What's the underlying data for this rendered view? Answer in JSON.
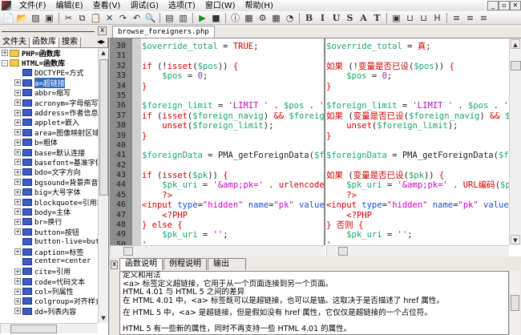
{
  "menu": [
    "文件(F)",
    "编辑(E)",
    "查看(V)",
    "调试(G)",
    "选项(T)",
    "窗口(W)",
    "帮助(H)"
  ],
  "window_controls": [
    "_",
    "▫",
    "✕"
  ],
  "toolbar": [
    "📄",
    "📂",
    "▨",
    "▣",
    "✂",
    "⧉",
    "📋",
    "✕",
    "↷",
    "↶",
    "🔍",
    "▤",
    "▥",
    "▶",
    "■",
    "ⓘ",
    "▦",
    "⚙",
    "▦",
    "◔",
    "B",
    "I",
    "U",
    "S",
    "A",
    "T",
    "▣",
    "⊔",
    "⊔",
    "H",
    "≡",
    "≡",
    "≡"
  ],
  "file_tab": "browse_foreigners.php",
  "left_panel": {
    "close": "x",
    "tabs": [
      "文件夫",
      "函数库",
      "搜索"
    ],
    "tab_arrows": [
      "◂",
      "▸"
    ],
    "tree": [
      {
        "label": "PHP=函数库",
        "type": "folder",
        "exp": "+",
        "level": 0
      },
      {
        "label": "HTML=函数库",
        "type": "folder",
        "exp": "-",
        "level": 0
      },
      {
        "label": "DOCTYPE=方式",
        "type": "page",
        "exp": "",
        "level": 1
      },
      {
        "label": "a=超链接",
        "type": "page",
        "exp": "+",
        "level": 1,
        "selected": true
      },
      {
        "label": "abbr=缩写",
        "type": "page",
        "exp": "+",
        "level": 1
      },
      {
        "label": "acronym=字母缩写",
        "type": "page",
        "exp": "+",
        "level": 1
      },
      {
        "label": "address=作者信息",
        "type": "page",
        "exp": "+",
        "level": 1
      },
      {
        "label": "applet=嵌入",
        "type": "page",
        "exp": "+",
        "level": 1
      },
      {
        "label": "area=图像映射区域",
        "type": "page",
        "exp": "+",
        "level": 1
      },
      {
        "label": "b=粗体",
        "type": "page",
        "exp": "+",
        "level": 1
      },
      {
        "label": "base=默认连接",
        "type": "page",
        "exp": "+",
        "level": 1
      },
      {
        "label": "basefont=基准字体",
        "type": "page",
        "exp": "+",
        "level": 1
      },
      {
        "label": "bdo=文字方向",
        "type": "page",
        "exp": "+",
        "level": 1
      },
      {
        "label": "bgsound=背景声音",
        "type": "page",
        "exp": "+",
        "level": 1
      },
      {
        "label": "big=大号字体",
        "type": "page",
        "exp": "+",
        "level": 1
      },
      {
        "label": "blockquote=引用块",
        "type": "page",
        "exp": "+",
        "level": 1
      },
      {
        "label": "body=主体",
        "type": "page",
        "exp": "+",
        "level": 1
      },
      {
        "label": "br=换行",
        "type": "page",
        "exp": "+",
        "level": 1
      },
      {
        "label": "button=按钮",
        "type": "page",
        "exp": "+",
        "level": 1
      },
      {
        "label": "button-live=butt",
        "type": "page",
        "exp": "",
        "level": 1
      },
      {
        "label": "caption=标签",
        "type": "page",
        "exp": "+",
        "level": 1
      },
      {
        "label": "center=center",
        "type": "page",
        "exp": "",
        "level": 1
      },
      {
        "label": "cite=引用",
        "type": "page",
        "exp": "+",
        "level": 1
      },
      {
        "label": "code=代码文本",
        "type": "page",
        "exp": "+",
        "level": 1
      },
      {
        "label": "col=列属性",
        "type": "page",
        "exp": "+",
        "level": 1
      },
      {
        "label": "colgroup=对齐样式",
        "type": "page",
        "exp": "+",
        "level": 1
      },
      {
        "label": "dd=列表内容",
        "type": "page",
        "exp": "+",
        "level": 1
      }
    ]
  },
  "editor": {
    "line_numbers": [
      "30",
      "31",
      "32",
      "33",
      "34",
      "35",
      "36",
      "37",
      "38",
      "39",
      "40",
      "41",
      "42",
      "43",
      "44",
      "45",
      "46",
      "47",
      "48",
      "49",
      "50"
    ],
    "left": [
      [
        [
          "v",
          "$override_total"
        ],
        [
          "p",
          " = "
        ],
        [
          "k",
          "TRUE"
        ],
        [
          "p",
          ";"
        ]
      ],
      [],
      [
        [
          "k",
          "if"
        ],
        [
          "p",
          " (!"
        ],
        [
          "k",
          "isset"
        ],
        [
          "p",
          "("
        ],
        [
          "v",
          "$pos"
        ],
        [
          "p",
          ")) "
        ],
        [
          "k",
          "{"
        ]
      ],
      [
        [
          "p",
          "    "
        ],
        [
          "v",
          "$pos"
        ],
        [
          "p",
          " = "
        ],
        [
          "n",
          "0"
        ],
        [
          "p",
          ";"
        ]
      ],
      [
        [
          "k",
          "}"
        ]
      ],
      [],
      [
        [
          "v",
          "$foreign_limit"
        ],
        [
          "p",
          " = "
        ],
        [
          "s",
          "'LIMIT '"
        ],
        [
          "p",
          " . "
        ],
        [
          "v",
          "$pos"
        ],
        [
          "p",
          " . "
        ],
        [
          "s",
          "', '"
        ],
        [
          "p",
          " . "
        ]
      ],
      [
        [
          "k",
          "if"
        ],
        [
          "p",
          " ("
        ],
        [
          "k",
          "isset"
        ],
        [
          "p",
          "("
        ],
        [
          "v",
          "$foreign_navig"
        ],
        [
          "p",
          ") "
        ],
        [
          "k",
          "&&"
        ],
        [
          "p",
          " "
        ],
        [
          "v",
          "$foreign_navi"
        ]
      ],
      [
        [
          "p",
          "    "
        ],
        [
          "k",
          "unset"
        ],
        [
          "p",
          "("
        ],
        [
          "v",
          "$foreign_limit"
        ],
        [
          "p",
          ");"
        ]
      ],
      [
        [
          "k",
          "}"
        ]
      ],
      [],
      [
        [
          "v",
          "$foreignData"
        ],
        [
          "p",
          " = PMA_getForeignData("
        ],
        [
          "v",
          "$foreign"
        ]
      ],
      [],
      [
        [
          "k",
          "if"
        ],
        [
          "p",
          " ("
        ],
        [
          "k",
          "isset"
        ],
        [
          "p",
          "("
        ],
        [
          "v",
          "$pk"
        ],
        [
          "p",
          ")) "
        ],
        [
          "k",
          "{"
        ]
      ],
      [
        [
          "p",
          "    "
        ],
        [
          "v",
          "$pk_uri"
        ],
        [
          "p",
          " = "
        ],
        [
          "s",
          "'&amp;pk='"
        ],
        [
          "p",
          " . "
        ],
        [
          "k",
          "urlencode"
        ],
        [
          "p",
          "("
        ],
        [
          "v",
          "$pk"
        ],
        [
          "p",
          ");"
        ]
      ],
      [
        [
          "p",
          "    "
        ],
        [
          "k",
          "?>"
        ]
      ],
      [
        [
          "o",
          "<input"
        ],
        [
          "p",
          " "
        ],
        [
          "a",
          "type"
        ],
        [
          "p",
          "="
        ],
        [
          "s",
          "\"hidden\""
        ],
        [
          "p",
          " "
        ],
        [
          "a",
          "name"
        ],
        [
          "p",
          "="
        ],
        [
          "s",
          "\"pk\""
        ],
        [
          "p",
          " "
        ],
        [
          "a",
          "value"
        ],
        [
          "p",
          "="
        ],
        [
          "s",
          "\"valu"
        ]
      ],
      [
        [
          "p",
          "    "
        ],
        [
          "k",
          "<?PHP"
        ]
      ],
      [
        [
          "k",
          "}"
        ],
        [
          "p",
          " "
        ],
        [
          "k",
          "else"
        ],
        [
          "p",
          " "
        ],
        [
          "k",
          "{"
        ]
      ],
      [
        [
          "p",
          "    "
        ],
        [
          "v",
          "$pk_uri"
        ],
        [
          "p",
          " = "
        ],
        [
          "s",
          "''"
        ],
        [
          "p",
          ";"
        ]
      ],
      [
        [
          "k",
          "'"
        ]
      ]
    ],
    "right": [
      [
        [
          "v",
          "$override_total"
        ],
        [
          "p",
          " = "
        ],
        [
          "k",
          "真"
        ],
        [
          "p",
          ";"
        ]
      ],
      [],
      [
        [
          "k",
          "如果"
        ],
        [
          "p",
          " (!"
        ],
        [
          "k",
          "变量是否已设"
        ],
        [
          "p",
          "("
        ],
        [
          "v",
          "$pos"
        ],
        [
          "p",
          ")) "
        ],
        [
          "k",
          "{"
        ]
      ],
      [
        [
          "p",
          "    "
        ],
        [
          "v",
          "$pos"
        ],
        [
          "p",
          " = "
        ],
        [
          "n",
          "0"
        ],
        [
          "p",
          ";"
        ]
      ],
      [
        [
          "k",
          "}"
        ]
      ],
      [],
      [
        [
          "v",
          "$foreign_limit"
        ],
        [
          "p",
          " = "
        ],
        [
          "s",
          "'LIMIT '"
        ],
        [
          "p",
          " . "
        ],
        [
          "v",
          "$pos"
        ],
        [
          "p",
          " . "
        ],
        [
          "s",
          "', '"
        ],
        [
          "p",
          " . "
        ]
      ],
      [
        [
          "k",
          "如果"
        ],
        [
          "p",
          " ("
        ],
        [
          "k",
          "变量是否已设"
        ],
        [
          "p",
          "("
        ],
        [
          "v",
          "$foreign_navig"
        ],
        [
          "p",
          ") "
        ],
        [
          "k",
          "&&"
        ],
        [
          "p",
          " "
        ],
        [
          "v",
          "$for"
        ]
      ],
      [
        [
          "p",
          "    "
        ],
        [
          "k",
          "unset"
        ],
        [
          "p",
          "("
        ],
        [
          "v",
          "$foreign_limit"
        ],
        [
          "p",
          ");"
        ]
      ],
      [
        [
          "k",
          "}"
        ]
      ],
      [],
      [
        [
          "v",
          "$foreignData"
        ],
        [
          "p",
          " = PMA_getForeignData("
        ],
        [
          "v",
          "$foreign"
        ]
      ],
      [],
      [
        [
          "k",
          "如果"
        ],
        [
          "p",
          " ("
        ],
        [
          "k",
          "变量是否已设"
        ],
        [
          "p",
          "("
        ],
        [
          "v",
          "$pk"
        ],
        [
          "p",
          ")) "
        ],
        [
          "k",
          "{"
        ]
      ],
      [
        [
          "p",
          "    "
        ],
        [
          "v",
          "$pk_uri"
        ],
        [
          "p",
          " = "
        ],
        [
          "s",
          "'&amp;pk='"
        ],
        [
          "p",
          " . "
        ],
        [
          "k",
          "URL编码"
        ],
        [
          "p",
          "("
        ],
        [
          "v",
          "$pk"
        ],
        [
          "p",
          ");"
        ]
      ],
      [
        [
          "p",
          "    "
        ],
        [
          "k",
          "?>"
        ]
      ],
      [
        [
          "o",
          "<input"
        ],
        [
          "p",
          " "
        ],
        [
          "a",
          "type"
        ],
        [
          "p",
          "="
        ],
        [
          "s",
          "\"hidden\""
        ],
        [
          "p",
          " "
        ],
        [
          "a",
          "name"
        ],
        [
          "p",
          "="
        ],
        [
          "s",
          "\"pk\""
        ],
        [
          "p",
          " "
        ],
        [
          "a",
          "value"
        ],
        [
          "p",
          "="
        ],
        [
          "s",
          "\"valu"
        ]
      ],
      [
        [
          "p",
          "    "
        ],
        [
          "k",
          "<?PHP"
        ]
      ],
      [
        [
          "k",
          "}"
        ],
        [
          "p",
          " "
        ],
        [
          "k",
          "否则"
        ],
        [
          "p",
          " "
        ],
        [
          "k",
          "{"
        ]
      ],
      [
        [
          "p",
          "    "
        ],
        [
          "v",
          "$pk_uri"
        ],
        [
          "p",
          " = "
        ],
        [
          "s",
          "''"
        ],
        [
          "p",
          ";"
        ]
      ],
      [
        [
          "k",
          "'"
        ]
      ]
    ]
  },
  "bottom": {
    "close": "x",
    "tabs": [
      "函数说明",
      "例程说明",
      "输出"
    ],
    "lines": [
      "定义和用法",
      "<a> 标签定义超链接，它用于从一个页面连接到另一个页面。",
      "HTML 4.01 与 HTML 5 之间的差异",
      "在 HTML 4.01 中，<a> 标签既可以是超链接，也可以是锚。这取决于是否描述了 href 属性。",
      "在 HTML 5 中，<a> 是超链接，但是假如没有 href 属性，它仅仅是超链接的一个占位符。",
      "HTML 5 有一些新的属性，同时不再支持一些 HTML 4.01 的属性。"
    ]
  },
  "colors": {
    "variable": "#1aa66a",
    "keyword": "#d20000",
    "string": "#d000c8",
    "attribute": "#1c4fd8",
    "selection": "#316ac5"
  }
}
